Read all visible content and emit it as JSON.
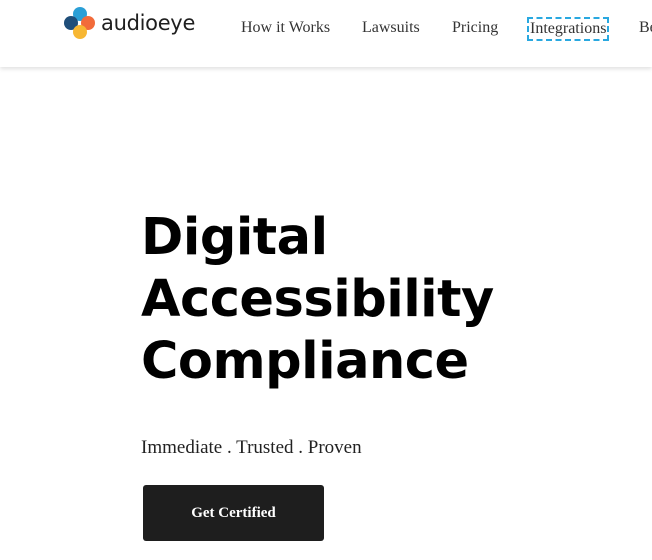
{
  "header": {
    "brand": {
      "name": "audioeye",
      "colors": {
        "top": "#2a9fd6",
        "left": "#1f4e79",
        "right": "#f26b3a",
        "bottom": "#f7b733"
      }
    },
    "nav": [
      {
        "label": "How it Works"
      },
      {
        "label": "Lawsuits"
      },
      {
        "label": "Pricing"
      },
      {
        "label": "Integrations",
        "focused": true
      },
      {
        "label": "Be"
      }
    ],
    "focus_outline_color": "#29a8e0"
  },
  "hero": {
    "title_lines": [
      "Digital",
      "Accessibility",
      "Compliance"
    ],
    "subtitle": "Immediate . Trusted . Proven",
    "cta_label": "Get Certified",
    "cta_color": "#1e1e1e"
  }
}
